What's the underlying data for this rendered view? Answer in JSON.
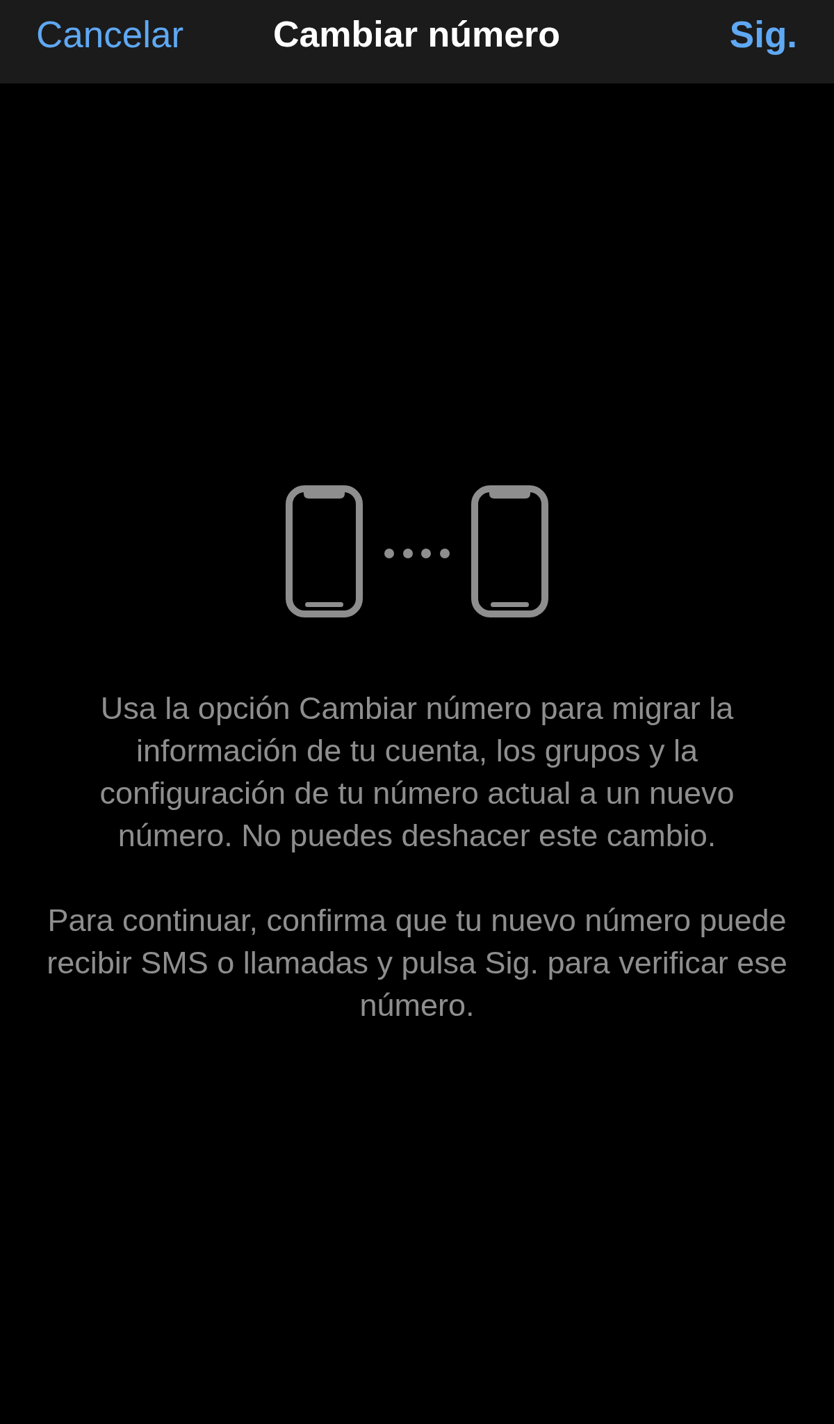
{
  "nav_bar": {
    "cancel_button": "Cancelar",
    "title": "Cambiar número",
    "next_button": "Sig."
  },
  "paragraphs": [
    "Usa la opción Cambiar número para migrar la información de tu cuenta, los grupos y la configuración de tu número actual a un nuevo número. No puedes deshacer este cambio.",
    "Para continuar, confirma que tu nuevo número puede recibir SMS o llamadas y pulsa Sig. para verificar ese número."
  ]
}
